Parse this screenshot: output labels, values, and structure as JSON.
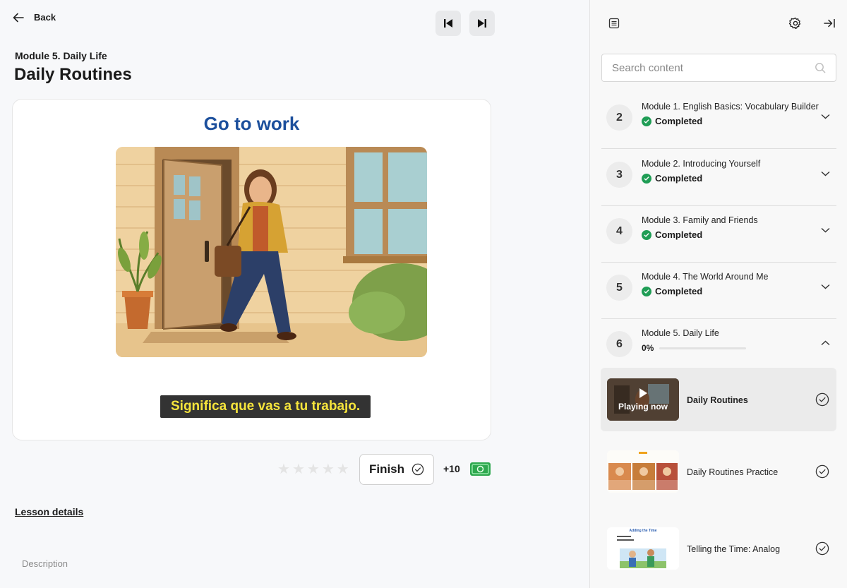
{
  "nav": {
    "back_label": "Back"
  },
  "lesson": {
    "module_label": "Module 5. Daily Life",
    "title": "Daily Routines",
    "slide_title": "Go to work",
    "caption": "Significa que vas a tu trabajo.",
    "rating": {
      "value": 0,
      "max": 5
    },
    "finish_label": "Finish",
    "points": "+10",
    "details_link": "Lesson details",
    "description_label": "Description"
  },
  "sidebar": {
    "search_placeholder": "Search content",
    "modules": [
      {
        "number": "2",
        "title": "Module 1. English Basics: Vocabulary Builder",
        "status": "Completed"
      },
      {
        "number": "3",
        "title": "Module 2. Introducing Yourself",
        "status": "Completed"
      },
      {
        "number": "4",
        "title": "Module 3. Family and Friends",
        "status": "Completed"
      },
      {
        "number": "5",
        "title": "Module 4. The World Around Me",
        "status": "Completed"
      },
      {
        "number": "6",
        "title": "Module 5. Daily Life",
        "progress_label": "0%",
        "progress": 0
      }
    ],
    "lessons": [
      {
        "title": "Daily Routines",
        "badge": "Playing now"
      },
      {
        "title": "Daily Routines Practice"
      },
      {
        "title": "Telling the Time: Analog",
        "thumb_title": "Adding the Time"
      }
    ]
  }
}
